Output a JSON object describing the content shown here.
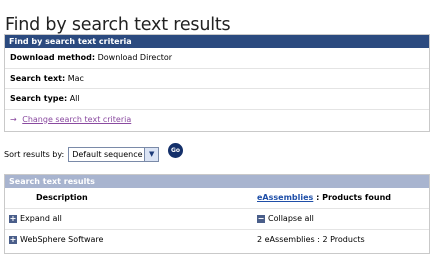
{
  "page": {
    "title": "Find by search text results"
  },
  "criteria": {
    "header": "Find by search text criteria",
    "download_method_label": "Download method:",
    "download_method_value": "Download Director",
    "search_text_label": "Search text:",
    "search_text_value": "Mac",
    "search_type_label": "Search type:",
    "search_type_value": "All",
    "change_link": "Change search text criteria"
  },
  "sort": {
    "label": "Sort results by:",
    "selected": "Default sequence",
    "go_label": "Go"
  },
  "results": {
    "header": "Search text results",
    "col_description": "Description",
    "col_eassemblies_link": "eAssemblies",
    "col_products_found": " : Products found",
    "expand_all": "Expand all",
    "collapse_all": "Collapse all",
    "rows": [
      {
        "description": "WebSphere Software",
        "found": "2 eAssemblies : 2 Products"
      }
    ]
  },
  "icons": {
    "expand": "plus-icon",
    "collapse": "minus-icon",
    "link_arrow": "arrow-right-icon",
    "dropdown": "chevron-down-icon"
  },
  "colors": {
    "criteria_header": "#2b4a7f",
    "results_header": "#a8b4cf",
    "link": "#8a4aa0",
    "go_button": "#14306a"
  }
}
